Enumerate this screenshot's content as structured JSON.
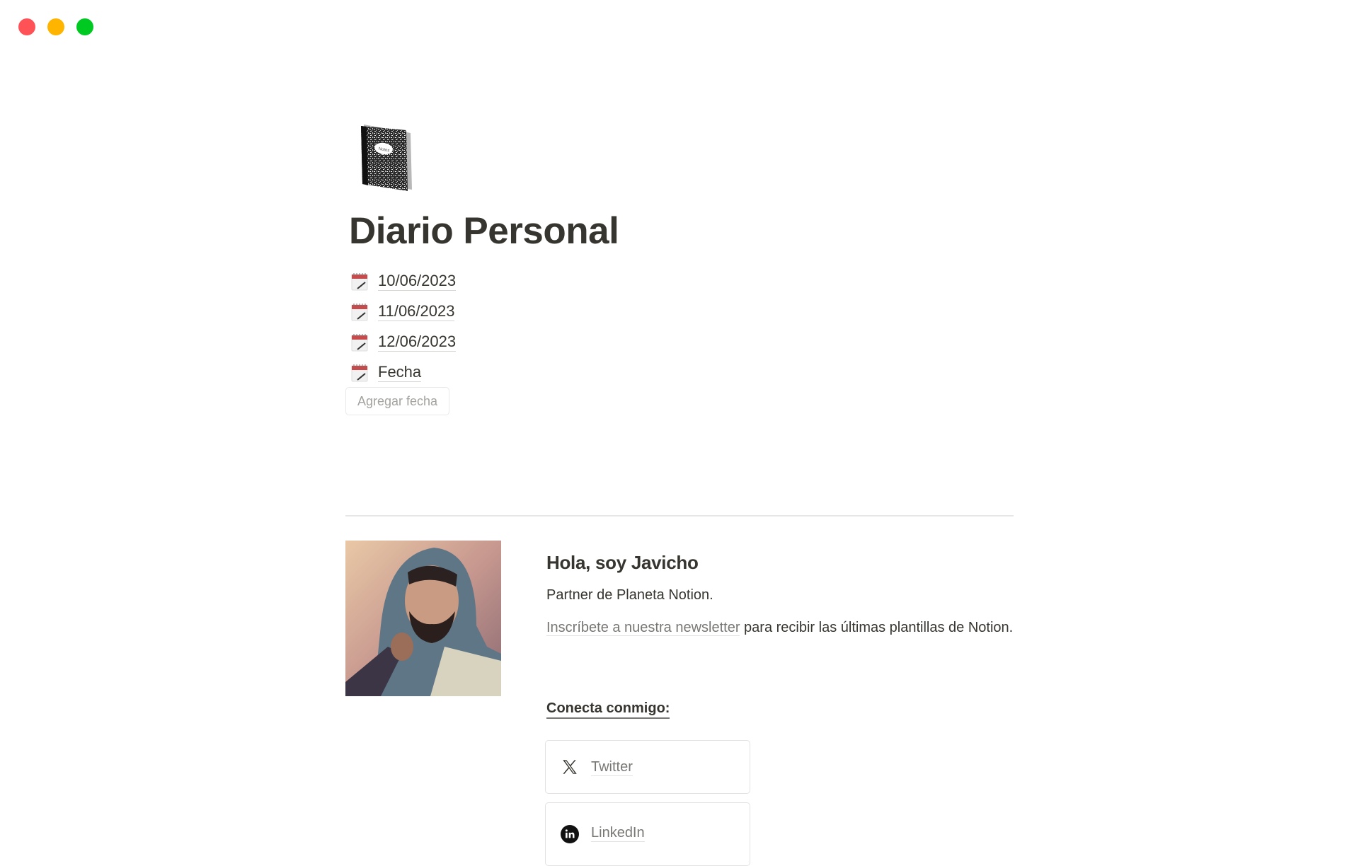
{
  "window": {
    "controls": [
      {
        "name": "close",
        "color": "#ff5257"
      },
      {
        "name": "minimize",
        "color": "#ffb400"
      },
      {
        "name": "maximize",
        "color": "#00c922"
      }
    ]
  },
  "page": {
    "icon": "notebook-icon",
    "title": "Diario Personal",
    "dates": [
      {
        "label": "10/06/2023",
        "icon": "calendar-icon"
      },
      {
        "label": "11/06/2023",
        "icon": "calendar-icon"
      },
      {
        "label": "12/06/2023",
        "icon": "calendar-icon"
      },
      {
        "label": "Fecha",
        "icon": "calendar-icon"
      }
    ],
    "add_date_button": "Agregar fecha"
  },
  "author": {
    "avatar_alt": "Retrato ilustrado de Javicho con capucha",
    "heading": "Hola, soy Javicho",
    "line1": "Partner de Planeta Notion.",
    "newsletter_link": "Inscríbete a nuestra newsletter",
    "newsletter_rest": " para recibir las últimas plantillas de Notion.",
    "connect_heading": "Conecta conmigo:",
    "socials": [
      {
        "label": "Twitter",
        "icon": "x-twitter-icon"
      },
      {
        "label": "LinkedIn",
        "icon": "linkedin-icon"
      }
    ]
  },
  "colors": {
    "text": "#37352f",
    "muted": "#787774",
    "border": "#e3e2e0"
  }
}
